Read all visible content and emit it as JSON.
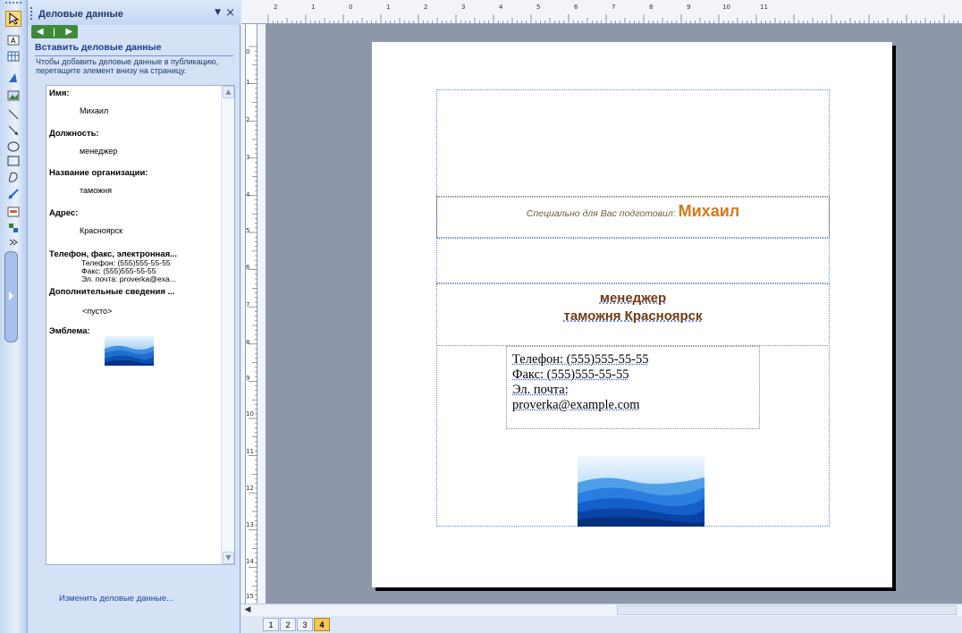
{
  "task_pane": {
    "title": "Деловые данные",
    "section_title": "Вставить деловые данные",
    "description": "Чтобы добавить деловые данные в публикацию, перетащите элемент внизу на страницу.",
    "fields": [
      {
        "label": "Имя:",
        "value": "Михаил"
      },
      {
        "label": "Должность:",
        "value": "менеджер"
      },
      {
        "label": "Название организации:",
        "value": "таможня"
      },
      {
        "label": "Адрес:",
        "value": "Красноярск"
      }
    ],
    "contact_field": {
      "label": "Телефон, факс, электронная...",
      "lines": [
        "Телефон: (555)555-55-55",
        "Факс: (555)555-55-55",
        "Эл. почта: proverka@exa..."
      ]
    },
    "extra_field": {
      "label": "Дополнительные сведения ...",
      "value": "<пусто>"
    },
    "logo_label": "Эмблема:",
    "edit_link": "Изменить деловые данные..."
  },
  "rulers": {
    "horizontal": [
      "2",
      "1",
      "0",
      "1",
      "2",
      "3",
      "4",
      "5",
      "6",
      "7",
      "8",
      "9",
      "10",
      "11"
    ],
    "vertical": [
      "0",
      "1",
      "2",
      "3",
      "4",
      "5",
      "6",
      "7",
      "8",
      "9",
      "10",
      "11",
      "12",
      "13",
      "14",
      "15"
    ]
  },
  "publication": {
    "greeting_intro": "Специально для Вас подготовил:",
    "greeting_name": "Михаил",
    "position": "менеджер",
    "organization_line": "таможня Красноярск",
    "contacts": [
      "Телефон: (555)555-55-55",
      "Факс: (555)555-55-55",
      "Эл. почта:",
      "proverka@example.com"
    ]
  },
  "pages": [
    "1",
    "2",
    "3",
    "4"
  ],
  "active_page": "4",
  "colors": {
    "name": "#d37a1d",
    "heading": "#6b3a14",
    "accent": "#1b3d8f"
  }
}
